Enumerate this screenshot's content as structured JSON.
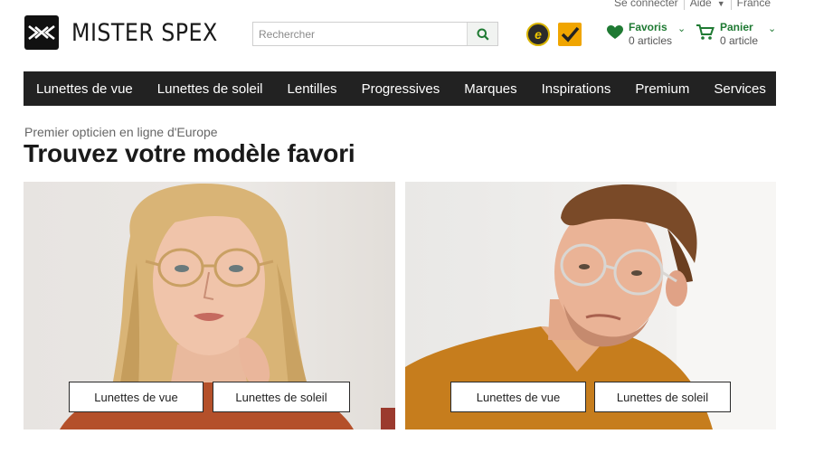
{
  "utility": {
    "login": "Se connecter",
    "help": "Aide",
    "country": "France"
  },
  "header": {
    "brand": "MISTER SPEX",
    "search_placeholder": "Rechercher",
    "favorites": {
      "label": "Favoris",
      "count_text": "0 articles"
    },
    "cart": {
      "label": "Panier",
      "count_text": "0 article"
    }
  },
  "nav": {
    "items": [
      "Lunettes de vue",
      "Lunettes de soleil",
      "Lentilles",
      "Progressives",
      "Marques",
      "Inspirations",
      "Premium",
      "Services"
    ]
  },
  "hero": {
    "kicker": "Premier opticien en ligne d'Europe",
    "title": "Trouvez votre modèle favori",
    "cards": [
      {
        "buttons": [
          "Lunettes de vue",
          "Lunettes de soleil"
        ]
      },
      {
        "buttons": [
          "Lunettes de vue",
          "Lunettes de soleil"
        ]
      }
    ]
  },
  "colors": {
    "accent_green": "#1f7a33",
    "nav_bg": "#222222",
    "trusted_badge": "#f0a500"
  },
  "icons": [
    "logo-mark-icon",
    "search-icon",
    "ekomi-badge-icon",
    "trusted-shops-icon",
    "heart-icon",
    "cart-icon",
    "chevron-down-icon"
  ]
}
